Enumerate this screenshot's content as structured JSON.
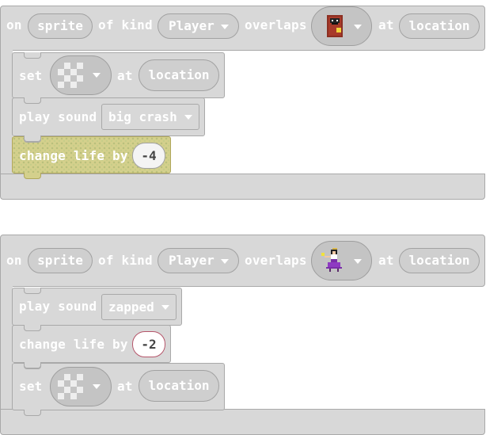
{
  "event1": {
    "on": "on",
    "sprite": "sprite",
    "of_kind": "of kind",
    "kind": "Player",
    "overlaps": "overlaps",
    "at": "at",
    "location": "location",
    "set_block": {
      "set": "set",
      "at": "at",
      "location": "location"
    },
    "sound_block": {
      "label": "play sound",
      "sound": "big crash"
    },
    "life_block": {
      "label": "change life by",
      "value": "-4"
    }
  },
  "event2": {
    "on": "on",
    "sprite": "sprite",
    "of_kind": "of kind",
    "kind": "Player",
    "overlaps": "overlaps",
    "at": "at",
    "location": "location",
    "sound_block": {
      "label": "play sound",
      "sound": "zapped"
    },
    "life_block": {
      "label": "change life by",
      "value": "-2"
    },
    "set_block": {
      "set": "set",
      "at": "at",
      "location": "location"
    }
  }
}
